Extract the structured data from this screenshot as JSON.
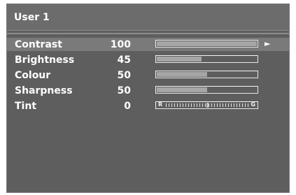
{
  "menu": {
    "title": "User 1",
    "items": [
      {
        "label": "Contrast",
        "value": "100",
        "level": 1.0,
        "selected": true,
        "type": "slider"
      },
      {
        "label": "Brightness",
        "value": "45",
        "level": 0.45,
        "selected": false,
        "type": "slider"
      },
      {
        "label": "Colour",
        "value": "50",
        "level": 0.5,
        "selected": false,
        "type": "slider"
      },
      {
        "label": "Sharpness",
        "value": "50",
        "level": 0.5,
        "selected": false,
        "type": "slider"
      },
      {
        "label": "Tint",
        "value": "0",
        "level": 0.5,
        "selected": false,
        "type": "balance",
        "left_end": "R",
        "right_end": "G"
      }
    ]
  },
  "icons": {
    "selected_indicator": "right-triangle-icon"
  },
  "colors": {
    "panel": "#5e5e5e",
    "header": "#6c6c6c",
    "selected_row": "#7a7a7a",
    "text": "#ffffff",
    "bar_fill": "#a6a6a6"
  }
}
